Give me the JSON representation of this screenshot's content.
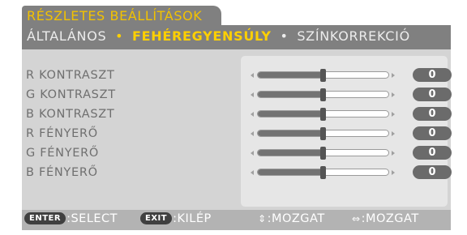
{
  "window": {
    "title": "RÉSZLETES BEÁLLÍTÁSOK"
  },
  "tabs": [
    {
      "label": "ÁLTALÁNOS",
      "active": false
    },
    {
      "label": "FEHÉREGYENSÚLY",
      "active": true
    },
    {
      "label": "SZÍNKORREKCIÓ",
      "active": false
    }
  ],
  "tab_separator": "•",
  "settings": [
    {
      "label": "R KONTRASZT",
      "value": "0",
      "level": 0.5
    },
    {
      "label": "G KONTRASZT",
      "value": "0",
      "level": 0.5
    },
    {
      "label": "B KONTRASZT",
      "value": "0",
      "level": 0.5
    },
    {
      "label": "R FÉNYERŐ",
      "value": "0",
      "level": 0.5
    },
    {
      "label": "G FÉNYERŐ",
      "value": "0",
      "level": 0.5
    },
    {
      "label": "B FÉNYERŐ",
      "value": "0",
      "level": 0.5
    }
  ],
  "help": [
    {
      "key": "ENTER",
      "text": ":SELECT",
      "icon": "enter-key-icon"
    },
    {
      "key": "EXIT",
      "text": ":KILÉP",
      "icon": "exit-key-icon"
    },
    {
      "key": "",
      "glyph": "⇕",
      "text": ":MOZGAT",
      "icon": "up-down-arrows-icon"
    },
    {
      "key": "",
      "glyph": "⇔",
      "text": ":MOZGAT",
      "icon": "left-right-arrows-icon"
    }
  ],
  "colors": {
    "accent": "#ffd000",
    "title": "#f2c200",
    "panel": "#d4d4d4",
    "header": "#808080"
  }
}
